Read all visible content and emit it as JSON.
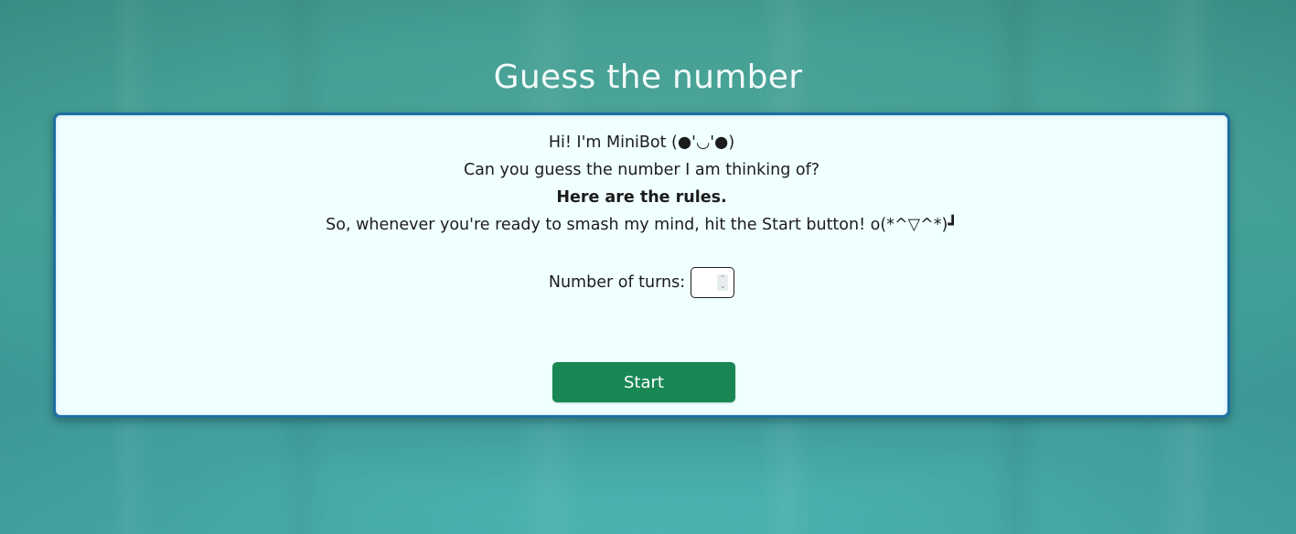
{
  "page": {
    "title": "Guess the number"
  },
  "intro": {
    "greeting": "Hi! I'm MiniBot (●'◡'●)",
    "question": "Can you guess the number I am thinking of?",
    "rules_heading": "Here are the rules.",
    "call_to_action": "So, whenever you're ready to smash my mind, hit the Start button! o(*^▽^*)┛"
  },
  "turns": {
    "label": "Number of turns:",
    "value": ""
  },
  "actions": {
    "start_label": "Start"
  },
  "colors": {
    "background": "#43a096",
    "card_background": "#f0ffff",
    "card_border": "#1f6fa0",
    "start_button": "#198754",
    "title_text": "#f3fbfa"
  }
}
